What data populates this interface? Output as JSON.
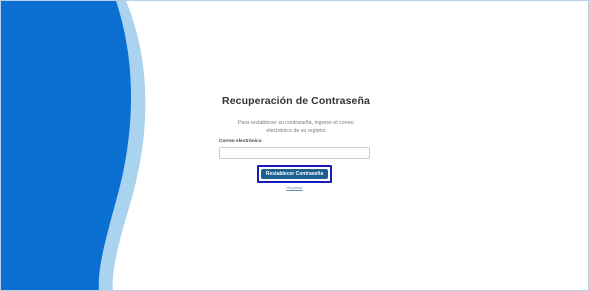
{
  "page": {
    "title": "Recuperación de Contraseña",
    "instructions": "Para restablecer su contraseña, ingrese el correo electrónico de su registro"
  },
  "form": {
    "email_label": "Correo electrónico",
    "email_value": "",
    "email_placeholder": "",
    "submit_label": "Restablecer Contraseña",
    "back_label": "Regresar"
  },
  "colors": {
    "primary_blue": "#0a6fd1",
    "light_blue": "#a9d3ef",
    "button_bg": "#1d5f8e",
    "highlight_border": "#1a1ab8"
  }
}
